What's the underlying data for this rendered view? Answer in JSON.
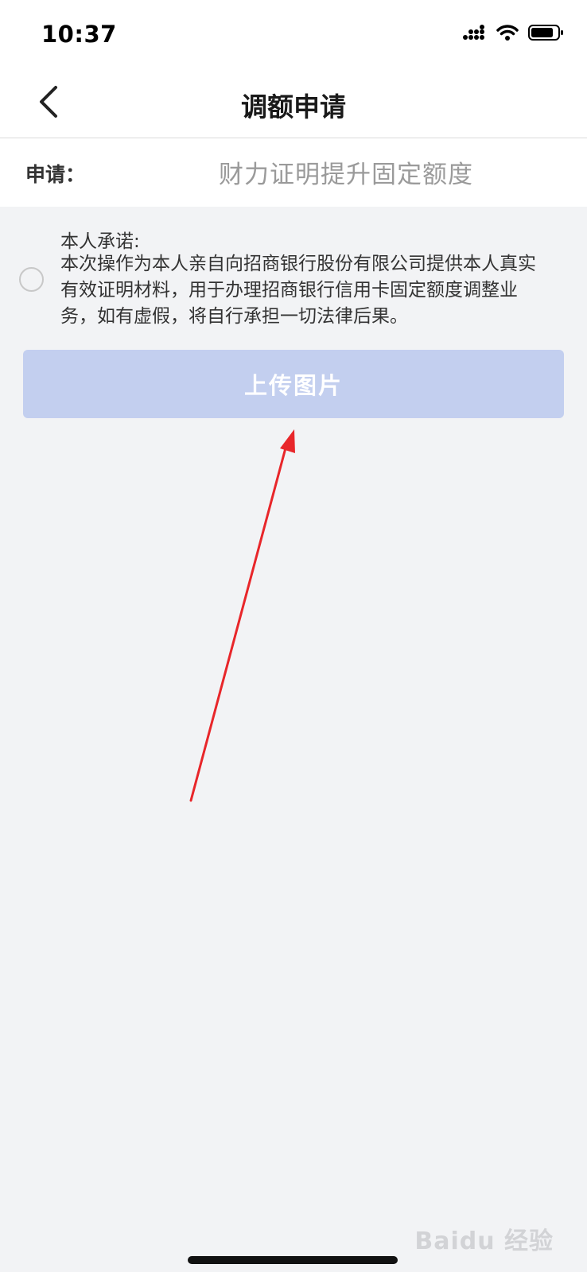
{
  "status_bar": {
    "time": "10:37",
    "icons": [
      "signal-icon",
      "wifi-icon",
      "battery-icon"
    ]
  },
  "header": {
    "back_icon": "chevron-left-icon",
    "title": "调额申请"
  },
  "apply": {
    "label": "申请：",
    "value": "财力证明提升固定额度"
  },
  "promise": {
    "checked": false,
    "title": "本人承诺:",
    "text": "本次操作为本人亲自向招商银行股份有限公司提供本人真实有效证明材料，用于办理招商银行信用卡固定额度调整业务，如有虚假，将自行承担一切法律后果。"
  },
  "upload": {
    "label": "上传图片"
  },
  "watermark": {
    "text": "Baidu 经验"
  },
  "colors": {
    "background": "#f2f3f5",
    "button_disabled": "#c3cfef",
    "annotation_arrow": "#e8262a",
    "placeholder_text": "#9a9a9a"
  }
}
